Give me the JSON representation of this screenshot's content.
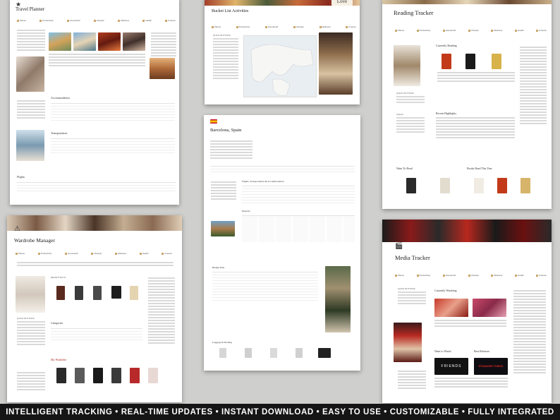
{
  "footer": {
    "tagline": "INTELLIGENT TRACKING • REAL-TIME UPDATES • INSTANT DOWNLOAD • EASY TO USE • CUSTOMIZABLE • FULLY INTEGRATED"
  },
  "cards": {
    "travel": {
      "title": "Travel Planner",
      "sub": "Accommodation",
      "sub2": "Transportation",
      "sub3": "Flights"
    },
    "bucket": {
      "title": "Bucket List Activities",
      "love": "Love",
      "quick": "QUICK BUTTONS",
      "places": "Places"
    },
    "reading": {
      "title": "Reading Tracker",
      "current": "Currently Reading",
      "recent": "Recent Highlights",
      "toread": "Want To Read",
      "read": "Books Read This Year",
      "quick": "QUICK BUTTONS",
      "upload": "Upload"
    },
    "barcelona": {
      "title": "Barcelona, Spain",
      "flights": "Flights, Transportation & Accommodation",
      "budget": "Budget Plan",
      "luggage": "Luggage & Packing",
      "itinerary": "Itinerary"
    },
    "wardrobe": {
      "title": "Wardrobe Manager",
      "categories": "Categories",
      "mywardrobe": "My Wardrobe",
      "quick": "QUICK BUTTONS",
      "recent": "RECENT BUYS"
    },
    "media": {
      "title": "Media Tracker",
      "watching": "Currently Watching",
      "towatch": "Want to Watch",
      "releases": "Best Releases",
      "quick": "QUICK BUTTONS",
      "friends": "FRIENDS",
      "stranger": "STRANGER THINGS"
    }
  },
  "nav": [
    "Places",
    "Productivity",
    "Household",
    "Lifestyle",
    "Wellness",
    "Health & Wellness",
    "Finance"
  ]
}
